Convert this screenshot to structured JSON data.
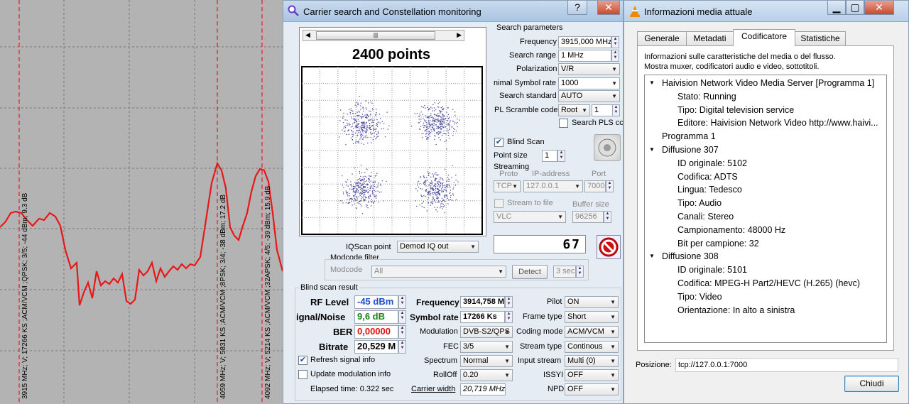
{
  "spectrum": {
    "labels": [
      "3915 MHz; V; 17266 KS ;ACM/VCM ;QPSK; 3/5; -44 dBm; 9.3 dB",
      "4059 MHz; V; 5831 KS ;ACM/VCM ;8PSK; 3/4; -38 dBm; 17.2 dB",
      "4092 MHz; V; 5214 KS ;ACM/VCM ;32APSK; 4/5; -39 dBm; 15.9 dB"
    ]
  },
  "carrier_window": {
    "title": "Carrier search and Constellation monitoring",
    "help_label": "?",
    "close_label": "✕",
    "constellation_title": "2400 points",
    "iqscan_label": "IQScan point",
    "iqscan_value": "Demod IQ out",
    "counter_value": "67",
    "modcode_filter_label": "Modcode filter",
    "modcode_label": "Modcode",
    "modcode_value": "All",
    "detect_label": "Detect",
    "detect_sec": "3 sec",
    "search_params": {
      "header": "Search parameters",
      "frequency_label": "Frequency",
      "frequency_value": "3915,000 MHz",
      "range_label": "Search range",
      "range_value": "1 MHz",
      "polarization_label": "Polarization",
      "polarization_value": "V/R",
      "symbol_label": "nimal Symbol rate",
      "symbol_value": "1000",
      "standard_label": "Search standard",
      "standard_value": "AUTO",
      "scramble_label": "PL Scramble code",
      "scramble_mode": "Root",
      "scramble_value": "1",
      "search_pls_label": "Search PLS cc"
    },
    "blind_scan_label": "Blind Scan",
    "point_size_label": "Point size",
    "point_size_value": "1",
    "streaming": {
      "header": "Streaming",
      "proto_label": "Proto",
      "ip_label": "IP-address",
      "port_label": "Port",
      "proto_value": "TCP",
      "ip_value": "127.0.0.1",
      "port_value": "7000",
      "stream_file_label": "Stream to file",
      "buffer_label": "Buffer size",
      "player_value": "VLC",
      "buffer_value": "96256"
    },
    "result": {
      "header": "Blind scan result",
      "rf_label": "RF Level",
      "rf_value": "-45 dBm",
      "sn_label": "ignal/Noise",
      "sn_value": "9,6 dB",
      "ber_label": "BER",
      "ber_value": "0,00000",
      "bitrate_label": "Bitrate",
      "bitrate_value": "20,529 M",
      "freq_label": "Frequency",
      "freq_value": "3914,758 M",
      "symrate_label": "Symbol rate",
      "symrate_value": "17266 Ks",
      "modulation_label": "Modulation",
      "modulation_value": "DVB-S2/QPS",
      "fec_label": "FEC",
      "fec_value": "3/5",
      "spectrum_label": "Spectrum",
      "spectrum_value": "Normal",
      "rolloff_label": "RollOff",
      "rolloff_value": "0.20",
      "carrier_width_label": "Carrier width",
      "carrier_width_value": "20,719 MHz",
      "pilot_label": "Pilot",
      "pilot_value": "ON",
      "frame_label": "Frame type",
      "frame_value": "Short",
      "coding_label": "Coding mode",
      "coding_value": "ACM/VCM",
      "stream_type_label": "Stream type",
      "stream_type_value": "Continous",
      "input_stream_label": "Input stream",
      "input_stream_value": "Multi (0)",
      "issyi_label": "ISSYI",
      "issyi_value": "OFF",
      "npd_label": "NPD",
      "npd_value": "OFF",
      "refresh_label": "Refresh signal info",
      "update_label": "Update modulation info",
      "elapsed_label": "Elapsed time: 0.322 sec"
    }
  },
  "media_window": {
    "title": "Informazioni media attuale",
    "tabs": [
      "Generale",
      "Metadati",
      "Codificatore",
      "Statistiche"
    ],
    "description_1": "Informazioni sulle caratteristiche del media o del flusso.",
    "description_2": "Mostra muxer, codificatori audio e video, sottotitoli.",
    "tree": [
      {
        "level": 0,
        "expander": "▼",
        "text": "Haivision Network Video Media Server [Programma 1]"
      },
      {
        "level": 1,
        "expander": "",
        "text": "Stato: Running"
      },
      {
        "level": 1,
        "expander": "",
        "text": "Tipo: Digital television service"
      },
      {
        "level": 1,
        "expander": "",
        "text": "Editore: Haivision Network Video http://www.haivi..."
      },
      {
        "level": 0,
        "expander": "",
        "text": "Programma 1"
      },
      {
        "level": 0,
        "expander": "▼",
        "text": "Diffusione 307"
      },
      {
        "level": 1,
        "expander": "",
        "text": "ID originale: 5102"
      },
      {
        "level": 1,
        "expander": "",
        "text": "Codifica: ADTS"
      },
      {
        "level": 1,
        "expander": "",
        "text": "Lingua: Tedesco"
      },
      {
        "level": 1,
        "expander": "",
        "text": "Tipo: Audio"
      },
      {
        "level": 1,
        "expander": "",
        "text": "Canali: Stereo"
      },
      {
        "level": 1,
        "expander": "",
        "text": "Campionamento: 48000 Hz"
      },
      {
        "level": 1,
        "expander": "",
        "text": "Bit per campione: 32"
      },
      {
        "level": 0,
        "expander": "▼",
        "text": "Diffusione 308"
      },
      {
        "level": 1,
        "expander": "",
        "text": "ID originale: 5101"
      },
      {
        "level": 1,
        "expander": "",
        "text": "Codifica: MPEG-H Part2/HEVC (H.265) (hevc)"
      },
      {
        "level": 1,
        "expander": "",
        "text": "Tipo: Video"
      },
      {
        "level": 1,
        "expander": "",
        "text": "Orientazione: In alto a sinistra"
      }
    ],
    "position_label": "Posizione:",
    "position_value": "tcp://127.0.0.1:7000",
    "close_button": "Chiudi"
  }
}
